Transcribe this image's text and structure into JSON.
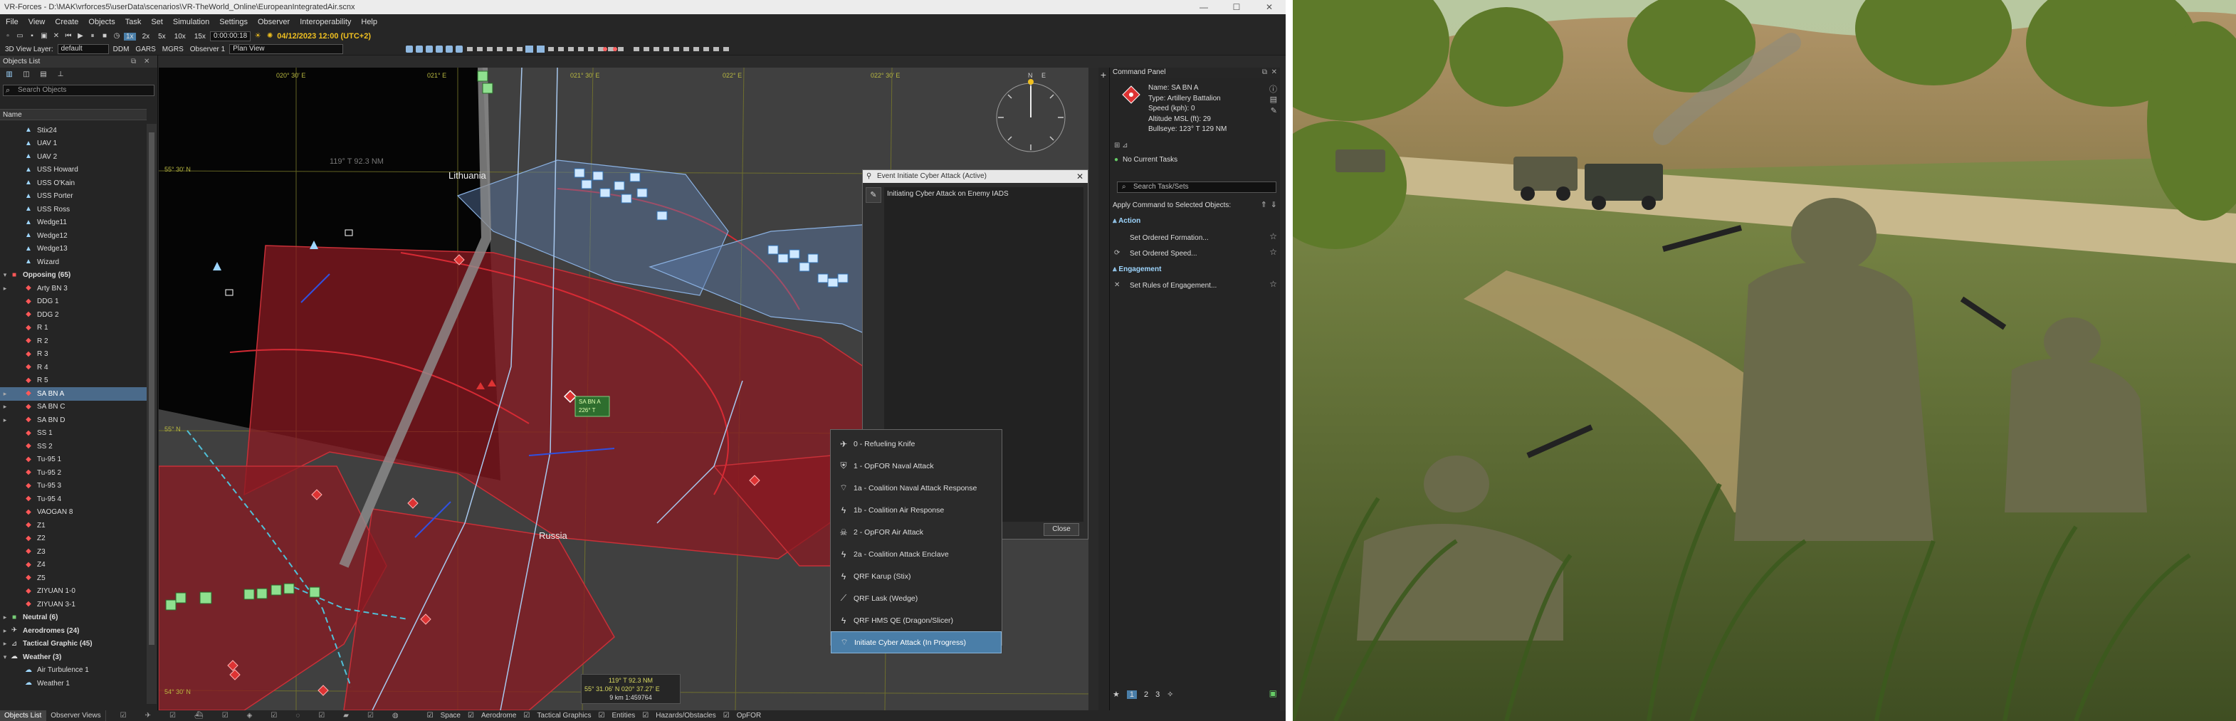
{
  "window": {
    "title": "VR-Forces - D:\\MAK\\vrforces5\\userData\\scenarios\\VR-TheWorld_Online\\EuropeanIntegratedAir.scnx",
    "min": "—",
    "max": "☐",
    "close": "✕"
  },
  "menu": [
    "File",
    "View",
    "Create",
    "Objects",
    "Task",
    "Set",
    "Simulation",
    "Settings",
    "Observer",
    "Interoperability",
    "Help"
  ],
  "toolbar": {
    "speeds": [
      "1x",
      "2x",
      "5x",
      "10x",
      "15x"
    ],
    "sim_time": "0:00:00:18",
    "date": "04/12/2023 12:00 (UTC+2)",
    "view_layer_label": "3D View Layer:",
    "view_layer_value": "default",
    "coord_formats": [
      "DDM",
      "GARS",
      "MGRS"
    ],
    "observer": "Observer 1",
    "view_mode": "Plan View"
  },
  "objects_list": {
    "title": "Objects List",
    "search_placeholder": "Search Objects",
    "column": "Name",
    "rows": [
      {
        "label": "Stix24",
        "type": "blue",
        "indent": 1
      },
      {
        "label": "UAV 1",
        "type": "blue",
        "indent": 1
      },
      {
        "label": "UAV 2",
        "type": "blue",
        "indent": 1
      },
      {
        "label": "USS Howard",
        "type": "blue",
        "indent": 1
      },
      {
        "label": "USS O'Kain",
        "type": "blue",
        "indent": 1
      },
      {
        "label": "USS Porter",
        "type": "blue",
        "indent": 1
      },
      {
        "label": "USS Ross",
        "type": "blue",
        "indent": 1
      },
      {
        "label": "Wedge11",
        "type": "blue",
        "indent": 1
      },
      {
        "label": "Wedge12",
        "type": "blue",
        "indent": 1
      },
      {
        "label": "Wedge13",
        "type": "blue",
        "indent": 1
      },
      {
        "label": "Wizard",
        "type": "blue",
        "indent": 1
      },
      {
        "label": "Opposing (65)",
        "type": "grp-red",
        "indent": 0,
        "exp": "▾"
      },
      {
        "label": "Arty BN 3",
        "type": "red",
        "indent": 1,
        "exp": "▸"
      },
      {
        "label": "DDG 1",
        "type": "red",
        "indent": 1
      },
      {
        "label": "DDG 2",
        "type": "red",
        "indent": 1
      },
      {
        "label": "R 1",
        "type": "red",
        "indent": 1
      },
      {
        "label": "R 2",
        "type": "red",
        "indent": 1
      },
      {
        "label": "R 3",
        "type": "red",
        "indent": 1
      },
      {
        "label": "R 4",
        "type": "red",
        "indent": 1
      },
      {
        "label": "R 5",
        "type": "red",
        "indent": 1
      },
      {
        "label": "SA BN A",
        "type": "red",
        "indent": 1,
        "exp": "▸",
        "sel": true
      },
      {
        "label": "SA BN C",
        "type": "red",
        "indent": 1,
        "exp": "▸"
      },
      {
        "label": "SA BN D",
        "type": "red",
        "indent": 1,
        "exp": "▸"
      },
      {
        "label": "SS 1",
        "type": "red",
        "indent": 1
      },
      {
        "label": "SS 2",
        "type": "red",
        "indent": 1
      },
      {
        "label": "Tu-95 1",
        "type": "red",
        "indent": 1
      },
      {
        "label": "Tu-95 2",
        "type": "red",
        "indent": 1
      },
      {
        "label": "Tu-95 3",
        "type": "red",
        "indent": 1
      },
      {
        "label": "Tu-95 4",
        "type": "red",
        "indent": 1
      },
      {
        "label": "VAOGAN 8",
        "type": "red",
        "indent": 1
      },
      {
        "label": "Z1",
        "type": "red",
        "indent": 1
      },
      {
        "label": "Z2",
        "type": "red",
        "indent": 1
      },
      {
        "label": "Z3",
        "type": "red",
        "indent": 1
      },
      {
        "label": "Z4",
        "type": "red",
        "indent": 1
      },
      {
        "label": "Z5",
        "type": "red",
        "indent": 1
      },
      {
        "label": "ZIYUAN 1-0",
        "type": "red",
        "indent": 1
      },
      {
        "label": "ZIYUAN 3-1",
        "type": "red",
        "indent": 1
      },
      {
        "label": "Neutral (6)",
        "type": "grp-green",
        "indent": 0,
        "exp": "▸"
      },
      {
        "label": "Aerodromes (24)",
        "type": "grp-plane",
        "indent": 0,
        "exp": "▸"
      },
      {
        "label": "Tactical Graphic (45)",
        "type": "grp-tac",
        "indent": 0,
        "exp": "▸"
      },
      {
        "label": "Weather (3)",
        "type": "grp-wx",
        "indent": 0,
        "exp": "▾"
      },
      {
        "label": "Air Turbulence 1",
        "type": "wx",
        "indent": 1
      },
      {
        "label": "Weather 1",
        "type": "wx",
        "indent": 1
      }
    ]
  },
  "bottom_tabs": [
    "Objects List",
    "Observer Views"
  ],
  "map": {
    "label_lithuania": "Lithuania",
    "label_russia": "Russia",
    "coord_top": [
      "020° 30' E",
      "021° E",
      "021° 30' E",
      "022° E",
      "022° 30' E"
    ],
    "coord_left": [
      "55° 30' N",
      "55° N",
      "54° 30' N"
    ],
    "range_label": "119° T 92.3 NM",
    "unit_tag_line1": "SA BN A",
    "unit_tag_line2": "226° T",
    "cursor_readout": [
      "119° T 92.3 NM",
      "55° 31.06' N 020° 37.27' E",
      "9 km  1:459764"
    ],
    "compass_n": "N",
    "compass_e": "E"
  },
  "statusbar": {
    "filters": [
      "Space",
      "Aerodrome",
      "Tactical Graphics",
      "Entities",
      "Hazards/Obstacles",
      "OpFOR"
    ]
  },
  "event_dialog": {
    "title": "Event Initiate Cyber Attack (Active)",
    "body": "Initiating Cyber Attack on Enemy IADS",
    "close_button": "Close",
    "close_x": "✕"
  },
  "context_menu": {
    "items": [
      {
        "label": "0 - Refueling Knife",
        "icon": "plane-icon"
      },
      {
        "label": "1 - OpFOR Naval Attack",
        "icon": "shield-icon"
      },
      {
        "label": "1a - Coalition Naval Attack Response",
        "icon": "radio-icon"
      },
      {
        "label": "1b - Coalition Air Response",
        "icon": "lightning-icon"
      },
      {
        "label": "2 - OpFOR Air Attack",
        "icon": "skull-icon"
      },
      {
        "label": "2a - Coalition Attack Enclave",
        "icon": "lightning-icon"
      },
      {
        "label": "QRF Karup (Stix)",
        "icon": "lightning-icon"
      },
      {
        "label": "QRF Lask (Wedge)",
        "icon": "slash-icon"
      },
      {
        "label": "QRF HMS QE (Dragon/Slicer)",
        "icon": "lightning-icon"
      },
      {
        "label": "Initiate Cyber Attack (In Progress)",
        "icon": "radio-icon",
        "highlight": true
      }
    ]
  },
  "command_panel": {
    "title": "Command Panel",
    "name": "Name: SA BN A",
    "type": "Type: Artillery Battalion",
    "speed": "Speed (kph): 0",
    "altitude": "Altitude MSL (ft): 29",
    "bullseye": "Bullseye: 123° T 129 NM",
    "tasks": "No Current Tasks",
    "search_placeholder": "Search Task/Sets",
    "apply_label": "Apply Command to Selected Objects:",
    "section_action": "Action",
    "action_items": [
      "Set Ordered Formation...",
      "Set Ordered Speed..."
    ],
    "section_engagement": "Engagement",
    "engagement_items": [
      "Set Rules of Engagement..."
    ],
    "pages": [
      "1",
      "2",
      "3"
    ]
  },
  "colors": {
    "blue_force": "#9ed6ff",
    "red_force": "#ff5858",
    "highlight": "#4a7ea8",
    "date_yellow": "#f0c020"
  }
}
